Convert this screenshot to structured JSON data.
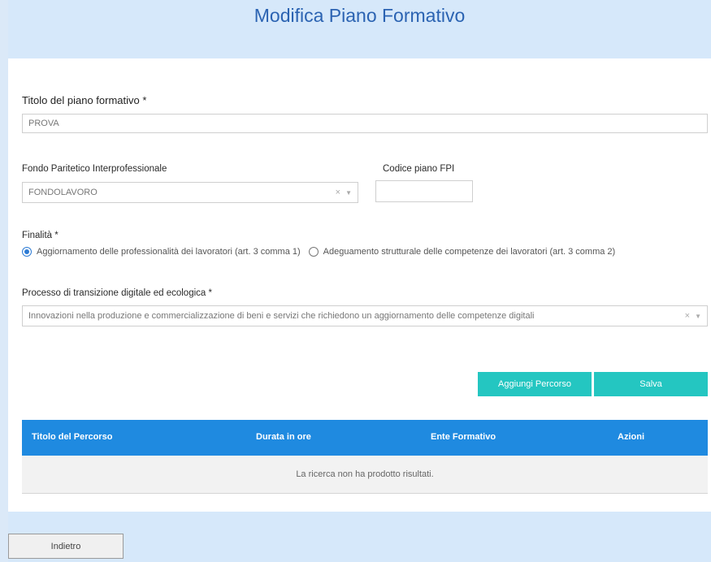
{
  "page": {
    "title": "Modifica Piano Formativo"
  },
  "form": {
    "titolo": {
      "label": "Titolo del piano formativo *",
      "value": "PROVA"
    },
    "fondo": {
      "label": "Fondo Paritetico Interprofessionale",
      "value": "FONDOLAVORO",
      "clear": "×",
      "caret": "▼"
    },
    "codice": {
      "label": "Codice piano FPI",
      "value": ""
    },
    "finalita": {
      "label": "Finalità *",
      "options": [
        {
          "label": "Aggiornamento delle professionalità dei lavoratori (art. 3 comma 1)",
          "checked": true
        },
        {
          "label": "Adeguamento strutturale delle competenze dei lavoratori (art. 3 comma 2)",
          "checked": false
        }
      ]
    },
    "processo": {
      "label": "Processo di transizione digitale ed ecologica *",
      "value": "Innovazioni nella produzione e commercializzazione di beni e servizi che richiedono un aggiornamento delle competenze digitali",
      "clear": "×",
      "caret": "▼"
    }
  },
  "actions": {
    "aggiungi": "Aggiungi Percorso",
    "salva": "Salva"
  },
  "table": {
    "columns": [
      "Titolo del Percorso",
      "Durata in ore",
      "Ente Formativo",
      "Azioni"
    ],
    "empty_message": "La ricerca non ha prodotto risultati."
  },
  "footer": {
    "back": "Indietro"
  },
  "colors": {
    "accent_blue": "#1f8ae0",
    "teal": "#24c6c1",
    "title_blue": "#2b63b2"
  }
}
